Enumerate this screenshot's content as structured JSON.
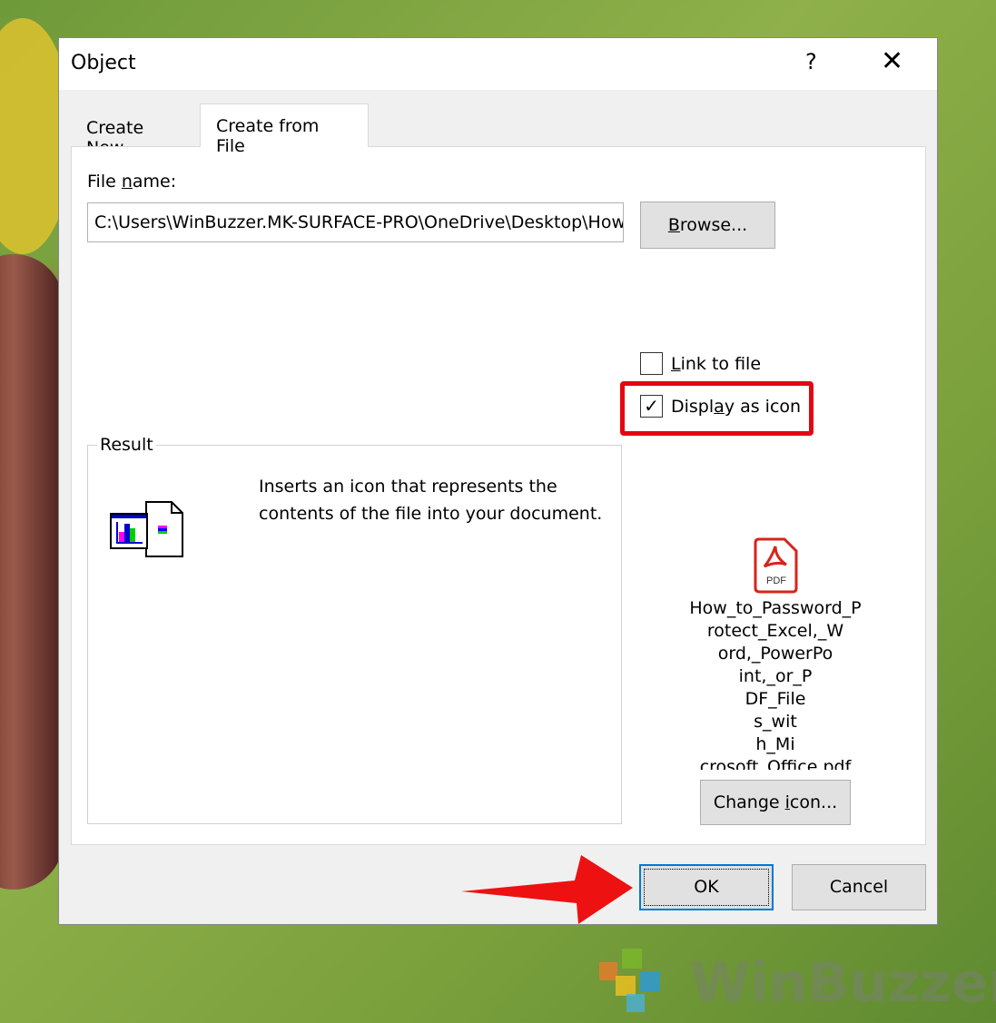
{
  "window": {
    "title": "Object",
    "help": "?",
    "close": "✕"
  },
  "tabs": [
    {
      "label": "Create New"
    },
    {
      "label": "Create from File"
    }
  ],
  "file_name": {
    "label_pre": "File ",
    "label_u": "n",
    "label_post": "ame:",
    "value": "C:\\Users\\WinBuzzer.MK-SURFACE-PRO\\OneDrive\\Desktop\\How_to_Password_Protect_Excel,_Word,_PowerPoint,_or_PDF_Files_with_Microsoft_Office.pdf"
  },
  "browse": {
    "u": "B",
    "rest": "rowse..."
  },
  "link_to_file": {
    "u": "L",
    "rest": "ink to file",
    "checked": false
  },
  "display_as_icon": {
    "pre": "Displ",
    "u": "a",
    "rest": "y as icon",
    "checked": true,
    "check": "✓"
  },
  "result": {
    "label": "Result",
    "description": "Inserts an icon that represents the contents of the file into your document."
  },
  "icon": {
    "badge": "PDF",
    "caption_lines": [
      "How_to_Password_P",
      "rotect_Excel,_W",
      "ord,_PowerPo",
      "int,_or_P",
      "DF_File",
      "s_wit",
      "h_Mi",
      "crosoft_Office.pdf"
    ]
  },
  "change_icon": {
    "pre": "Change ",
    "u": "i",
    "rest": "con..."
  },
  "ok": "OK",
  "cancel": "Cancel",
  "watermark": "WinBuzzer",
  "colors": {
    "highlight": "#e30613",
    "arrow": "#ee1111",
    "focus": "#0078d7"
  }
}
